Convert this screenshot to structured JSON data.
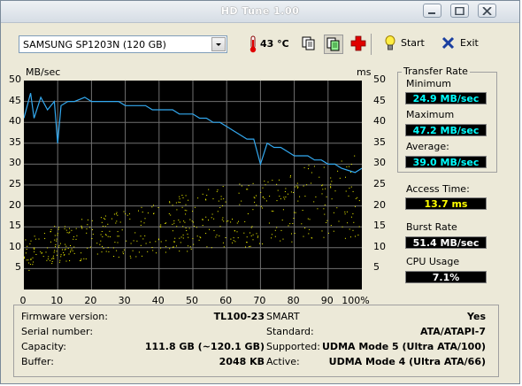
{
  "window": {
    "title": "HD Tune 1.00"
  },
  "toolbar": {
    "drive_select": "SAMSUNG SP1203N (120 GB)",
    "temperature": "43 °C",
    "start_label": "Start",
    "exit_label": "Exit"
  },
  "graph": {
    "left_unit": "MB/sec",
    "right_unit": "ms",
    "y_ticks_left": [
      "50",
      "45",
      "40",
      "35",
      "30",
      "25",
      "20",
      "15",
      "10",
      "5"
    ],
    "y_ticks_right": [
      "50",
      "45",
      "40",
      "35",
      "30",
      "25",
      "20",
      "15",
      "10",
      "5"
    ],
    "x_ticks": [
      "0",
      "10",
      "20",
      "30",
      "40",
      "50",
      "60",
      "70",
      "80",
      "90",
      "100%"
    ],
    "transfer_color": "#33a9f0",
    "access_color": "#ffff00"
  },
  "chart_data": {
    "type": "line",
    "xlabel": "",
    "ylabel": "MB/sec",
    "y2label": "ms",
    "xlim": [
      0,
      100
    ],
    "ylim": [
      0,
      50
    ],
    "grid": true,
    "series": [
      {
        "x": [
          0,
          2,
          3,
          5,
          7,
          9,
          10,
          11,
          13,
          15,
          18,
          20,
          22,
          24,
          26,
          28,
          30,
          32,
          34,
          36,
          38,
          40,
          42,
          44,
          46,
          48,
          50,
          52,
          54,
          56,
          58,
          60,
          62,
          64,
          66,
          68,
          70,
          72,
          74,
          76,
          78,
          80,
          82,
          84,
          86,
          88,
          90,
          92,
          94,
          96,
          98,
          100
        ],
        "y": [
          41,
          47,
          41,
          46,
          43,
          45,
          35,
          44,
          45,
          45,
          46,
          45,
          45,
          45,
          45,
          45,
          44,
          44,
          44,
          44,
          43,
          43,
          43,
          43,
          42,
          42,
          42,
          41,
          41,
          40,
          40,
          39,
          38,
          37,
          36,
          36,
          30,
          35,
          34,
          34,
          33,
          32,
          32,
          32,
          31,
          31,
          30,
          30,
          29,
          28.5,
          28,
          29
        ]
      },
      {
        "x": [
          0,
          5,
          10,
          15,
          20,
          25,
          30,
          35,
          40,
          45,
          50,
          55,
          60,
          65,
          70,
          75,
          80,
          85,
          90,
          95,
          100
        ],
        "y": [
          8,
          10,
          11,
          12,
          12,
          13,
          13,
          14,
          15,
          16,
          16,
          17,
          18,
          18,
          19,
          19,
          20,
          21,
          21,
          22,
          23
        ]
      }
    ]
  },
  "stats": {
    "transfer_rate_label": "Transfer Rate",
    "minimum_label": "Minimum",
    "minimum": "24.9 MB/sec",
    "maximum_label": "Maximum",
    "maximum": "47.2 MB/sec",
    "average_label": "Average:",
    "average": "39.0 MB/sec",
    "access_time_label": "Access Time:",
    "access_time": "13.7 ms",
    "burst_rate_label": "Burst Rate",
    "burst_rate": "51.4 MB/sec",
    "cpu_usage_label": "CPU Usage",
    "cpu_usage": "7.1%"
  },
  "info": {
    "firmware_label": "Firmware version:",
    "firmware": "TL100-23",
    "serial_label": "Serial number:",
    "serial": "",
    "capacity_label": "Capacity:",
    "capacity": "111.8 GB (~120.1 GB)",
    "buffer_label": "Buffer:",
    "buffer": "2048 KB",
    "smart_label": "SMART",
    "smart": "Yes",
    "standard_label": "Standard:",
    "standard": "ATA/ATAPI-7",
    "supported_label": "Supported:",
    "supported": "UDMA Mode 5 (Ultra ATA/100)",
    "active_label": "Active:",
    "active": "UDMA Mode 4 (Ultra ATA/66)"
  }
}
